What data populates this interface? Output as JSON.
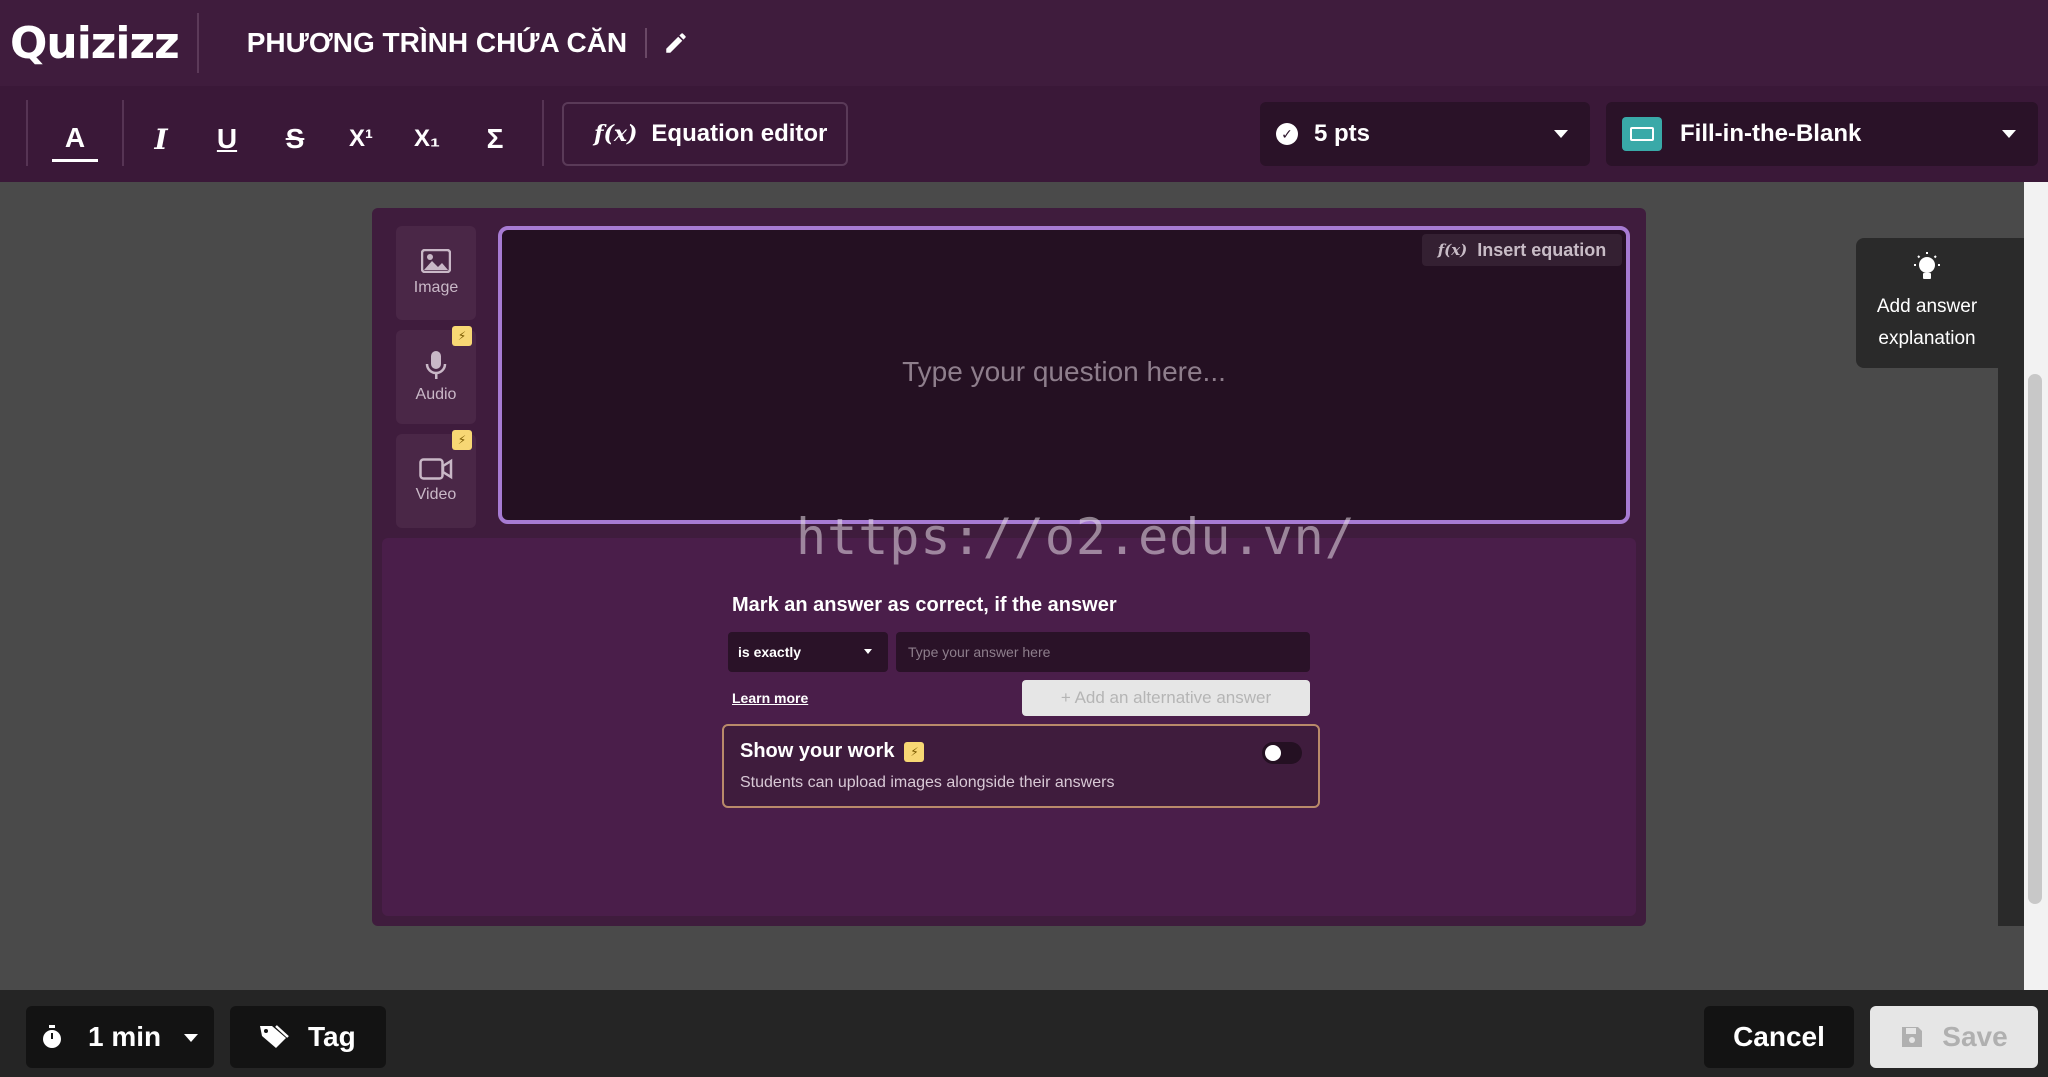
{
  "header": {
    "logo": "Quizizz",
    "quiz_title": "PHƯƠNG TRÌNH CHỨA CĂN"
  },
  "toolbar": {
    "text_color": "A",
    "italic": "I",
    "underline": "U",
    "strike": "S",
    "superscript": "X¹",
    "subscript": "X₁",
    "sigma": "Σ",
    "equation_editor": "Equation editor",
    "fx": "f(x)",
    "points": "5 pts",
    "question_type": "Fill-in-the-Blank"
  },
  "media": {
    "image": "Image",
    "audio": "Audio",
    "video": "Video"
  },
  "question": {
    "insert_equation": "Insert equation",
    "placeholder": "Type your question here..."
  },
  "answer": {
    "mark_label": "Mark an answer as correct, if the answer",
    "match_mode": "is exactly",
    "input_placeholder": "Type your answer here",
    "learn_more": "Learn more",
    "add_alternative": "+ Add an alternative answer"
  },
  "show_work": {
    "title": "Show your work",
    "description": "Students can upload images alongside their answers"
  },
  "explanation": {
    "label": "Add answer explanation"
  },
  "watermark": "https://o2.edu.vn/",
  "footer": {
    "time": "1 min",
    "tag": "Tag",
    "cancel": "Cancel",
    "save": "Save"
  },
  "colors": {
    "header_bg": "#3f1c3d",
    "accent_border": "#a77bd3",
    "fib_icon": "#39a9a8",
    "bolt_badge": "#f7d774"
  }
}
